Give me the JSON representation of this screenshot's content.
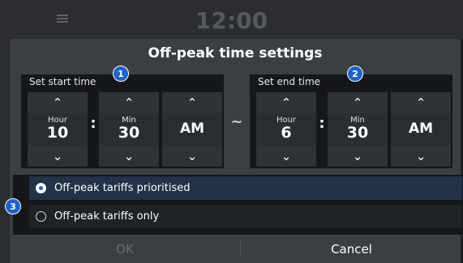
{
  "header": {
    "clock": "12:00"
  },
  "dialog": {
    "title": "Off-peak time settings"
  },
  "start": {
    "label": "Set start time",
    "badge": "1",
    "hour_label": "Hour",
    "hour": "10",
    "min_label": "Min",
    "min": "30",
    "ampm": "AM"
  },
  "end": {
    "label": "Set end time",
    "badge": "2",
    "hour_label": "Hour",
    "hour": "6",
    "min_label": "Min",
    "min": "30",
    "ampm": "AM"
  },
  "separator": {
    "colon": ":",
    "tilde": "~"
  },
  "options": {
    "badge": "3",
    "items": [
      {
        "label": "Off-peak tariffs prioritised",
        "selected": true
      },
      {
        "label": "Off-peak tariffs only",
        "selected": false
      }
    ]
  },
  "buttons": {
    "ok": "OK",
    "cancel": "Cancel"
  },
  "icons": {
    "up": "chevron-up-icon",
    "down": "chevron-down-icon",
    "menu": "menu-icon"
  },
  "colors": {
    "accent": "#1d63c9",
    "dialog_bg": "#3b3e43",
    "panel_bg": "#15171a"
  }
}
